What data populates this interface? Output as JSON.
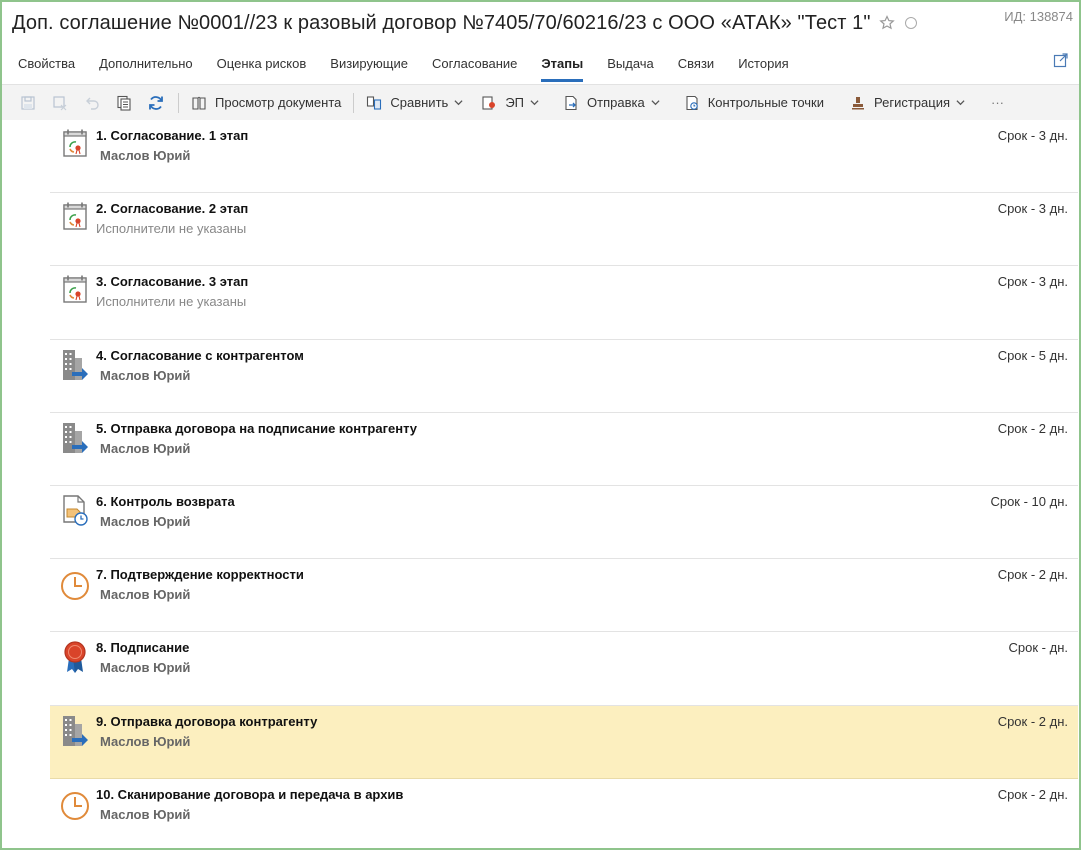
{
  "header": {
    "title": "Доп. соглашение №0001//23 к разовый договор №7405/70/60216/23 с ООО «АТАК» \"Тест 1\"",
    "id_label": "ИД: 138874"
  },
  "tabs": [
    {
      "label": "Свойства"
    },
    {
      "label": "Дополнительно"
    },
    {
      "label": "Оценка рисков"
    },
    {
      "label": "Визирующие"
    },
    {
      "label": "Согласование"
    },
    {
      "label": "Этапы",
      "active": true
    },
    {
      "label": "Выдача"
    },
    {
      "label": "Связи"
    },
    {
      "label": "История"
    }
  ],
  "toolbar": {
    "view_document": "Просмотр документа",
    "compare": "Сравнить",
    "ep": "ЭП",
    "send": "Отправка",
    "checkpoints": "Контрольные точки",
    "registration": "Регистрация",
    "more": "···"
  },
  "stages": [
    {
      "title": "1. Согласование. 1 этап",
      "sub": "Маслов Юрий",
      "term": "Срок - 3 дн.",
      "icon": "calendar-approval-icon"
    },
    {
      "title": "2. Согласование. 2 этап",
      "sub": "Исполнители не указаны",
      "term": "Срок - 3 дн.",
      "icon": "calendar-approval-icon"
    },
    {
      "title": "3. Согласование. 3 этап",
      "sub": "Исполнители не указаны",
      "term": "Срок - 3 дн.",
      "icon": "calendar-approval-icon"
    },
    {
      "title": "4. Согласование с контрагентом",
      "sub": "Маслов Юрий",
      "term": "Срок - 5 дн.",
      "icon": "building-send-icon"
    },
    {
      "title": "5. Отправка договора на подписание контрагенту",
      "sub": "Маслов Юрий",
      "term": "Срок - 2 дн.",
      "icon": "building-send-icon"
    },
    {
      "title": "6. Контроль возврата",
      "sub": "Маслов Юрий",
      "term": "Срок - 10 дн.",
      "icon": "document-return-icon"
    },
    {
      "title": "7. Подтверждение корректности",
      "sub": "Маслов Юрий",
      "term": "Срок - 2 дн.",
      "icon": "clock-icon"
    },
    {
      "title": "8. Подписание",
      "sub": "Маслов Юрий",
      "term": "Срок -  дн.",
      "icon": "seal-icon"
    },
    {
      "title": "9. Отправка договора контрагенту",
      "sub": "Маслов Юрий",
      "term": "Срок - 2 дн.",
      "icon": "building-send-icon",
      "highlight": true
    },
    {
      "title": "10. Сканирование договора и передача в архив",
      "sub": "Маслов Юрий",
      "term": "Срок - 2 дн.",
      "icon": "clock-icon"
    }
  ],
  "colors": {
    "accent": "#2a6ebb",
    "highlight": "#fcefbf",
    "frame_border": "#8fc48c",
    "clock": "#e08a3a",
    "seal": "#d9442a",
    "building": "#8a8a8a"
  }
}
